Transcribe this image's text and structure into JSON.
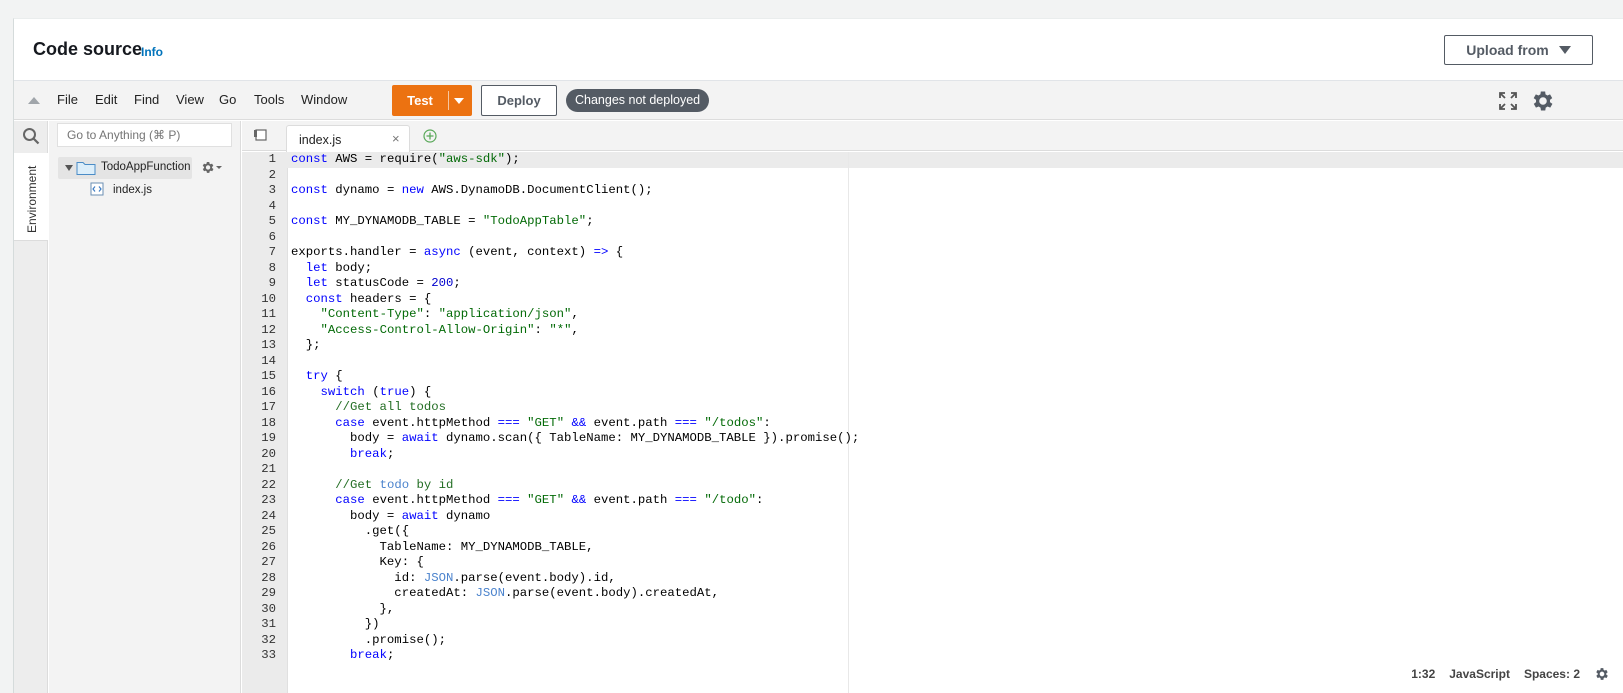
{
  "header": {
    "title": "Code source",
    "info_link": "Info",
    "upload_button": "Upload from"
  },
  "menubar": {
    "items": [
      "File",
      "Edit",
      "Find",
      "View",
      "Go",
      "Tools",
      "Window"
    ],
    "test_button": "Test",
    "deploy_button": "Deploy",
    "status_badge": "Changes not deployed"
  },
  "sidebar": {
    "environment_tab": "Environment",
    "goto_placeholder": "Go to Anything (⌘ P)",
    "root_folder": "TodoAppFunction",
    "files": [
      "index.js"
    ]
  },
  "editor": {
    "active_tab": "index.js",
    "close_glyph": "×",
    "lines": [
      {
        "n": "1",
        "t": [
          [
            "k",
            "const"
          ],
          [
            "p",
            " AWS = require("
          ],
          [
            "s",
            "\"aws-sdk\""
          ],
          [
            "p",
            ");"
          ]
        ]
      },
      {
        "n": "2",
        "t": []
      },
      {
        "n": "3",
        "t": [
          [
            "k",
            "const"
          ],
          [
            "p",
            " dynamo = "
          ],
          [
            "k",
            "new"
          ],
          [
            "p",
            " AWS.DynamoDB.DocumentClient();"
          ]
        ]
      },
      {
        "n": "4",
        "t": []
      },
      {
        "n": "5",
        "t": [
          [
            "k",
            "const"
          ],
          [
            "p",
            " MY_DYNAMODB_TABLE = "
          ],
          [
            "s",
            "\"TodoAppTable\""
          ],
          [
            "p",
            ";"
          ]
        ]
      },
      {
        "n": "6",
        "t": []
      },
      {
        "n": "7",
        "t": [
          [
            "p",
            "exports.handler = "
          ],
          [
            "k",
            "async"
          ],
          [
            "p",
            " (event, context) "
          ],
          [
            "k",
            "=>"
          ],
          [
            "p",
            " {"
          ]
        ]
      },
      {
        "n": "8",
        "t": [
          [
            "p",
            "  "
          ],
          [
            "k",
            "let"
          ],
          [
            "p",
            " body;"
          ]
        ]
      },
      {
        "n": "9",
        "t": [
          [
            "p",
            "  "
          ],
          [
            "k",
            "let"
          ],
          [
            "p",
            " statusCode = "
          ],
          [
            "n",
            "200"
          ],
          [
            "p",
            ";"
          ]
        ]
      },
      {
        "n": "10",
        "t": [
          [
            "p",
            "  "
          ],
          [
            "k",
            "const"
          ],
          [
            "p",
            " headers = {"
          ]
        ]
      },
      {
        "n": "11",
        "t": [
          [
            "p",
            "    "
          ],
          [
            "s",
            "\"Content-Type\""
          ],
          [
            "p",
            ": "
          ],
          [
            "s",
            "\"application/json\""
          ],
          [
            "p",
            ","
          ]
        ]
      },
      {
        "n": "12",
        "t": [
          [
            "p",
            "    "
          ],
          [
            "s",
            "\"Access-Control-Allow-Origin\""
          ],
          [
            "p",
            ": "
          ],
          [
            "s",
            "\"*\""
          ],
          [
            "p",
            ","
          ]
        ]
      },
      {
        "n": "13",
        "t": [
          [
            "p",
            "  };"
          ]
        ]
      },
      {
        "n": "14",
        "t": []
      },
      {
        "n": "15",
        "t": [
          [
            "p",
            "  "
          ],
          [
            "k",
            "try"
          ],
          [
            "p",
            " {"
          ]
        ]
      },
      {
        "n": "16",
        "t": [
          [
            "p",
            "    "
          ],
          [
            "k",
            "switch"
          ],
          [
            "p",
            " ("
          ],
          [
            "k",
            "true"
          ],
          [
            "p",
            ") {"
          ]
        ]
      },
      {
        "n": "17",
        "t": [
          [
            "p",
            "      "
          ],
          [
            "c",
            "//Get all todos"
          ]
        ]
      },
      {
        "n": "18",
        "t": [
          [
            "p",
            "      "
          ],
          [
            "k",
            "case"
          ],
          [
            "p",
            " event.httpMethod "
          ],
          [
            "k",
            "==="
          ],
          [
            "p",
            " "
          ],
          [
            "s",
            "\"GET\""
          ],
          [
            "p",
            " "
          ],
          [
            "k",
            "&&"
          ],
          [
            "p",
            " event.path "
          ],
          [
            "k",
            "==="
          ],
          [
            "p",
            " "
          ],
          [
            "s",
            "\"/todos\""
          ],
          [
            "p",
            ":"
          ]
        ]
      },
      {
        "n": "19",
        "t": [
          [
            "p",
            "        body = "
          ],
          [
            "k",
            "await"
          ],
          [
            "p",
            " dynamo.scan({ TableName: MY_DYNAMODB_TABLE }).promise();"
          ]
        ]
      },
      {
        "n": "20",
        "t": [
          [
            "p",
            "        "
          ],
          [
            "k",
            "break"
          ],
          [
            "p",
            ";"
          ]
        ]
      },
      {
        "n": "21",
        "t": []
      },
      {
        "n": "22",
        "t": [
          [
            "p",
            "      "
          ],
          [
            "c",
            "//Get "
          ],
          [
            "cv",
            "todo"
          ],
          [
            "c",
            " by id"
          ]
        ]
      },
      {
        "n": "23",
        "t": [
          [
            "p",
            "      "
          ],
          [
            "k",
            "case"
          ],
          [
            "p",
            " event.httpMethod "
          ],
          [
            "k",
            "==="
          ],
          [
            "p",
            " "
          ],
          [
            "s",
            "\"GET\""
          ],
          [
            "p",
            " "
          ],
          [
            "k",
            "&&"
          ],
          [
            "p",
            " event.path "
          ],
          [
            "k",
            "==="
          ],
          [
            "p",
            " "
          ],
          [
            "s",
            "\"/todo\""
          ],
          [
            "p",
            ":"
          ]
        ]
      },
      {
        "n": "24",
        "t": [
          [
            "p",
            "        body = "
          ],
          [
            "k",
            "await"
          ],
          [
            "p",
            " dynamo"
          ]
        ]
      },
      {
        "n": "25",
        "t": [
          [
            "p",
            "          .get({"
          ]
        ]
      },
      {
        "n": "26",
        "t": [
          [
            "p",
            "            TableName: MY_DYNAMODB_TABLE,"
          ]
        ]
      },
      {
        "n": "27",
        "t": [
          [
            "p",
            "            Key: {"
          ]
        ]
      },
      {
        "n": "28",
        "t": [
          [
            "p",
            "              id: "
          ],
          [
            "cv",
            "JSON"
          ],
          [
            "p",
            ".parse(event.body).id,"
          ]
        ]
      },
      {
        "n": "29",
        "t": [
          [
            "p",
            "              createdAt: "
          ],
          [
            "cv",
            "JSON"
          ],
          [
            "p",
            ".parse(event.body).createdAt,"
          ]
        ]
      },
      {
        "n": "30",
        "t": [
          [
            "p",
            "            },"
          ]
        ]
      },
      {
        "n": "31",
        "t": [
          [
            "p",
            "          })"
          ]
        ]
      },
      {
        "n": "32",
        "t": [
          [
            "p",
            "          .promise();"
          ]
        ]
      },
      {
        "n": "33",
        "t": [
          [
            "p",
            "        "
          ],
          [
            "k",
            "break"
          ],
          [
            "p",
            ";"
          ]
        ]
      }
    ]
  },
  "statusbar": {
    "cursor": "1:32",
    "language": "JavaScript",
    "spaces": "Spaces: 2"
  },
  "colors": {
    "accent_orange": "#ec7211",
    "link_blue": "#0073bb",
    "badge_gray": "#545b64",
    "keyword": "#0000ff",
    "string": "#036a07"
  },
  "icons": [
    "search-icon",
    "folder-icon",
    "file-icon",
    "gear-icon",
    "fullscreen-icon",
    "add-tab-icon",
    "tab-menu-icon",
    "collapse-icon"
  ]
}
